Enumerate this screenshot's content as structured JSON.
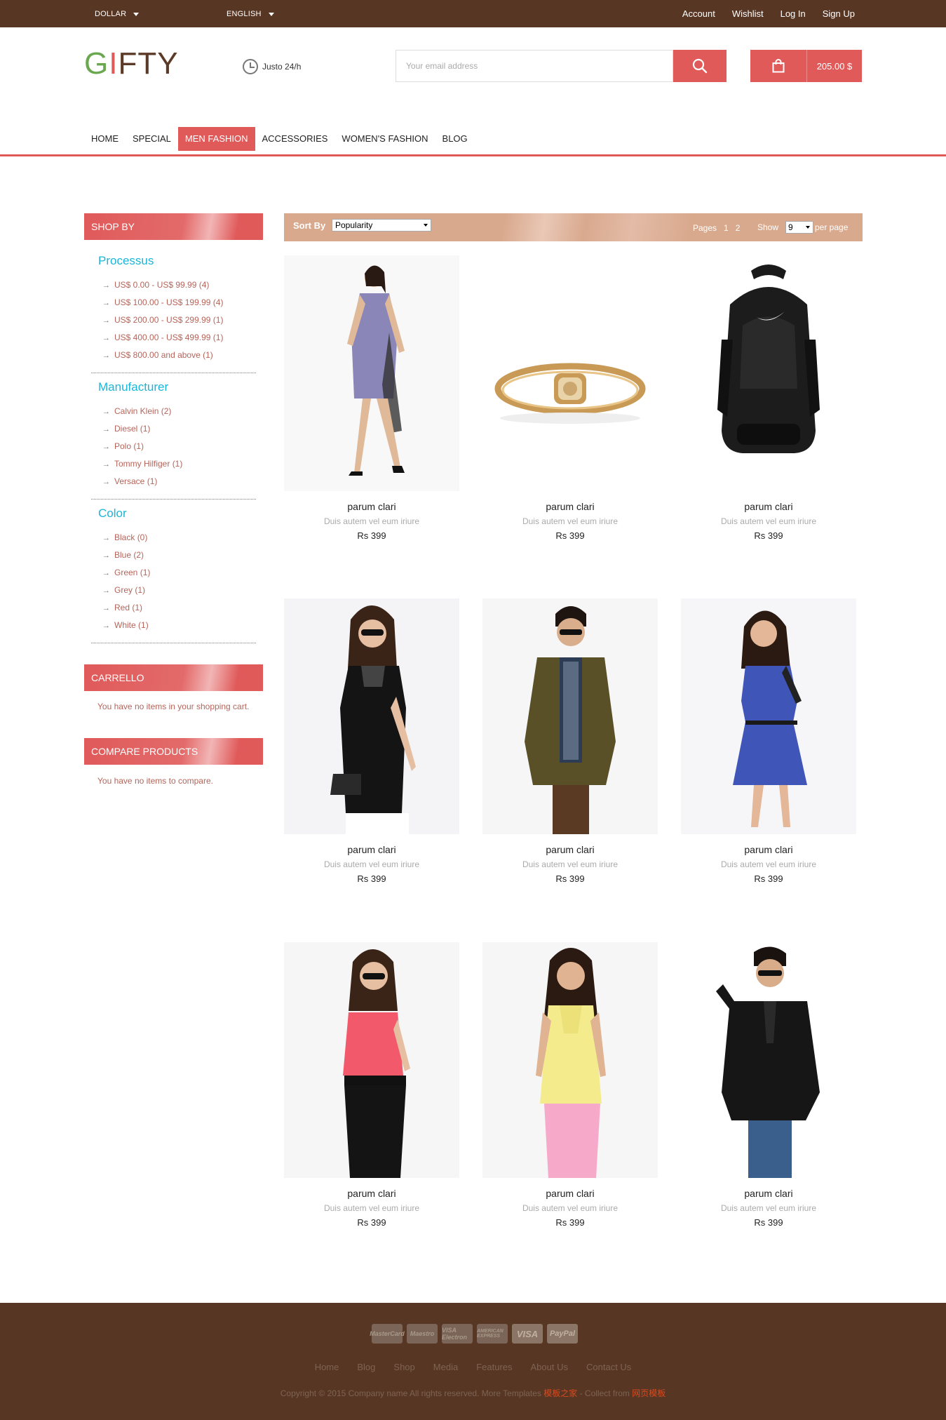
{
  "topbar": {
    "currency": "DOLLAR",
    "language": "ENGLISH",
    "links": [
      "Account",
      "Wishlist",
      "Log In",
      "Sign Up"
    ]
  },
  "header": {
    "logo_parts": [
      "G",
      "I",
      "FTY"
    ],
    "hours": "Justo 24/h",
    "search_placeholder": "Your email address",
    "cart_total": "205.00 $"
  },
  "nav": {
    "items": [
      "HOME",
      "SPECIAL",
      "MEN FASHION",
      "ACCESSORIES",
      "WOMEN'S FASHION",
      "BLOG"
    ],
    "active": "MEN FASHION"
  },
  "sidebar": {
    "shop_by": "SHOP BY",
    "processus": {
      "title": "Processus",
      "items": [
        {
          "label": "US$ 0.00 - US$ 99.99",
          "count": "(4)"
        },
        {
          "label": "US$ 100.00 - US$ 199.99",
          "count": "(4)"
        },
        {
          "label": "US$ 200.00 - US$ 299.99",
          "count": "(1)"
        },
        {
          "label": "US$ 400.00 - US$ 499.99",
          "count": "(1)"
        },
        {
          "label": "US$ 800.00 and above",
          "count": "(1)"
        }
      ]
    },
    "manufacturer": {
      "title": "Manufacturer",
      "items": [
        {
          "label": "Calvin Klein",
          "count": "(2)"
        },
        {
          "label": "Diesel",
          "count": "(1)"
        },
        {
          "label": "Polo",
          "count": "(1)"
        },
        {
          "label": "Tommy Hilfiger",
          "count": "(1)"
        },
        {
          "label": "Versace",
          "count": "(1)"
        }
      ]
    },
    "color": {
      "title": "Color",
      "items": [
        {
          "label": "Black",
          "count": "(0)"
        },
        {
          "label": "Blue",
          "count": "(2)"
        },
        {
          "label": "Green",
          "count": "(1)"
        },
        {
          "label": "Grey",
          "count": "(1)"
        },
        {
          "label": "Red",
          "count": "(1)"
        },
        {
          "label": "White",
          "count": "(1)"
        }
      ]
    },
    "cart": {
      "title": "CARRELLO",
      "text": "You have no items in your shopping cart."
    },
    "compare": {
      "title": "COMPARE PRODUCTS",
      "text": "You have no items to compare."
    }
  },
  "sortbar": {
    "sort_label": "Sort By",
    "sort_value": "Popularity",
    "pages_label": "Pages",
    "pages": [
      "1",
      "2"
    ],
    "show_label": "Show",
    "show_value": "9",
    "per_page": "per page"
  },
  "products": [
    {
      "name": "parum clari",
      "desc": "Duis autem vel eum iriure",
      "price": "Rs 399",
      "image": "dress-model"
    },
    {
      "name": "parum clari",
      "desc": "Duis autem vel eum iriure",
      "price": "Rs 399",
      "image": "gold-bracelet"
    },
    {
      "name": "parum clari",
      "desc": "Duis autem vel eum iriure",
      "price": "Rs 399",
      "image": "black-backpack"
    },
    {
      "name": "parum clari",
      "desc": "Duis autem vel eum iriure",
      "price": "Rs 399",
      "image": "black-top-model"
    },
    {
      "name": "parum clari",
      "desc": "Duis autem vel eum iriure",
      "price": "Rs 399",
      "image": "olive-jacket-model"
    },
    {
      "name": "parum clari",
      "desc": "Duis autem vel eum iriure",
      "price": "Rs 399",
      "image": "blue-dress-model"
    },
    {
      "name": "parum clari",
      "desc": "Duis autem vel eum iriure",
      "price": "Rs 399",
      "image": "pink-top-model"
    },
    {
      "name": "parum clari",
      "desc": "Duis autem vel eum iriure",
      "price": "Rs 399",
      "image": "yellow-top-model"
    },
    {
      "name": "parum clari",
      "desc": "Duis autem vel eum iriure",
      "price": "Rs 399",
      "image": "black-jacket-model"
    }
  ],
  "footer": {
    "payments": [
      "MasterCard",
      "Maestro",
      "VISA Electron",
      "AMERICAN EXPRESS",
      "VISA",
      "PayPal"
    ],
    "links": [
      "Home",
      "Blog",
      "Shop",
      "Media",
      "Features",
      "About Us",
      "Contact Us"
    ],
    "copyright": "Copyright © 2015 Company name All rights reserved. More Templates",
    "link1": "模板之家",
    "middle": " - Collect from ",
    "link2": "网页模板"
  },
  "colors": {
    "brand_brown": "#573624",
    "accent_red": "#e05a5a",
    "filter_title": "#1ab5d8",
    "sortbar": "#d9a98e"
  }
}
